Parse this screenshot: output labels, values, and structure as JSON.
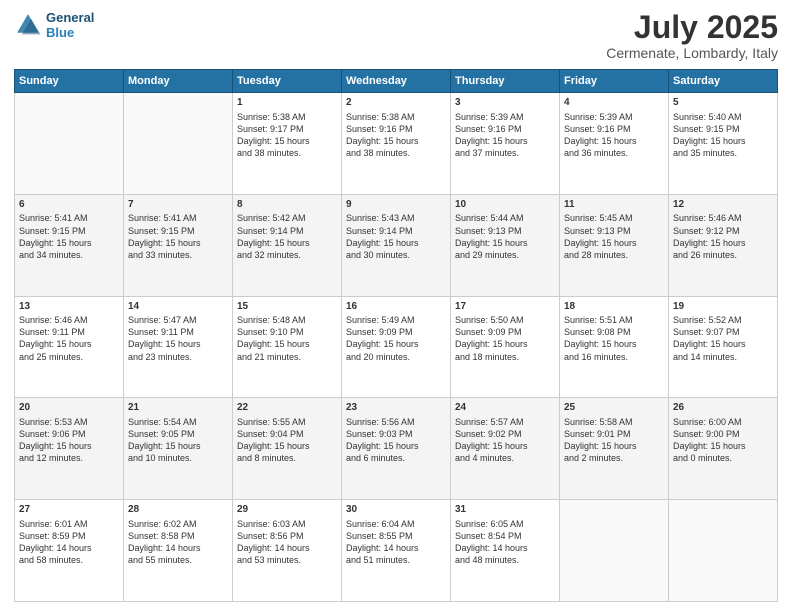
{
  "header": {
    "logo_line1": "General",
    "logo_line2": "Blue",
    "month": "July 2025",
    "location": "Cermenate, Lombardy, Italy"
  },
  "weekdays": [
    "Sunday",
    "Monday",
    "Tuesday",
    "Wednesday",
    "Thursday",
    "Friday",
    "Saturday"
  ],
  "rows": [
    [
      {
        "day": "",
        "text": ""
      },
      {
        "day": "",
        "text": ""
      },
      {
        "day": "1",
        "text": "Sunrise: 5:38 AM\nSunset: 9:17 PM\nDaylight: 15 hours\nand 38 minutes."
      },
      {
        "day": "2",
        "text": "Sunrise: 5:38 AM\nSunset: 9:16 PM\nDaylight: 15 hours\nand 38 minutes."
      },
      {
        "day": "3",
        "text": "Sunrise: 5:39 AM\nSunset: 9:16 PM\nDaylight: 15 hours\nand 37 minutes."
      },
      {
        "day": "4",
        "text": "Sunrise: 5:39 AM\nSunset: 9:16 PM\nDaylight: 15 hours\nand 36 minutes."
      },
      {
        "day": "5",
        "text": "Sunrise: 5:40 AM\nSunset: 9:15 PM\nDaylight: 15 hours\nand 35 minutes."
      }
    ],
    [
      {
        "day": "6",
        "text": "Sunrise: 5:41 AM\nSunset: 9:15 PM\nDaylight: 15 hours\nand 34 minutes."
      },
      {
        "day": "7",
        "text": "Sunrise: 5:41 AM\nSunset: 9:15 PM\nDaylight: 15 hours\nand 33 minutes."
      },
      {
        "day": "8",
        "text": "Sunrise: 5:42 AM\nSunset: 9:14 PM\nDaylight: 15 hours\nand 32 minutes."
      },
      {
        "day": "9",
        "text": "Sunrise: 5:43 AM\nSunset: 9:14 PM\nDaylight: 15 hours\nand 30 minutes."
      },
      {
        "day": "10",
        "text": "Sunrise: 5:44 AM\nSunset: 9:13 PM\nDaylight: 15 hours\nand 29 minutes."
      },
      {
        "day": "11",
        "text": "Sunrise: 5:45 AM\nSunset: 9:13 PM\nDaylight: 15 hours\nand 28 minutes."
      },
      {
        "day": "12",
        "text": "Sunrise: 5:46 AM\nSunset: 9:12 PM\nDaylight: 15 hours\nand 26 minutes."
      }
    ],
    [
      {
        "day": "13",
        "text": "Sunrise: 5:46 AM\nSunset: 9:11 PM\nDaylight: 15 hours\nand 25 minutes."
      },
      {
        "day": "14",
        "text": "Sunrise: 5:47 AM\nSunset: 9:11 PM\nDaylight: 15 hours\nand 23 minutes."
      },
      {
        "day": "15",
        "text": "Sunrise: 5:48 AM\nSunset: 9:10 PM\nDaylight: 15 hours\nand 21 minutes."
      },
      {
        "day": "16",
        "text": "Sunrise: 5:49 AM\nSunset: 9:09 PM\nDaylight: 15 hours\nand 20 minutes."
      },
      {
        "day": "17",
        "text": "Sunrise: 5:50 AM\nSunset: 9:09 PM\nDaylight: 15 hours\nand 18 minutes."
      },
      {
        "day": "18",
        "text": "Sunrise: 5:51 AM\nSunset: 9:08 PM\nDaylight: 15 hours\nand 16 minutes."
      },
      {
        "day": "19",
        "text": "Sunrise: 5:52 AM\nSunset: 9:07 PM\nDaylight: 15 hours\nand 14 minutes."
      }
    ],
    [
      {
        "day": "20",
        "text": "Sunrise: 5:53 AM\nSunset: 9:06 PM\nDaylight: 15 hours\nand 12 minutes."
      },
      {
        "day": "21",
        "text": "Sunrise: 5:54 AM\nSunset: 9:05 PM\nDaylight: 15 hours\nand 10 minutes."
      },
      {
        "day": "22",
        "text": "Sunrise: 5:55 AM\nSunset: 9:04 PM\nDaylight: 15 hours\nand 8 minutes."
      },
      {
        "day": "23",
        "text": "Sunrise: 5:56 AM\nSunset: 9:03 PM\nDaylight: 15 hours\nand 6 minutes."
      },
      {
        "day": "24",
        "text": "Sunrise: 5:57 AM\nSunset: 9:02 PM\nDaylight: 15 hours\nand 4 minutes."
      },
      {
        "day": "25",
        "text": "Sunrise: 5:58 AM\nSunset: 9:01 PM\nDaylight: 15 hours\nand 2 minutes."
      },
      {
        "day": "26",
        "text": "Sunrise: 6:00 AM\nSunset: 9:00 PM\nDaylight: 15 hours\nand 0 minutes."
      }
    ],
    [
      {
        "day": "27",
        "text": "Sunrise: 6:01 AM\nSunset: 8:59 PM\nDaylight: 14 hours\nand 58 minutes."
      },
      {
        "day": "28",
        "text": "Sunrise: 6:02 AM\nSunset: 8:58 PM\nDaylight: 14 hours\nand 55 minutes."
      },
      {
        "day": "29",
        "text": "Sunrise: 6:03 AM\nSunset: 8:56 PM\nDaylight: 14 hours\nand 53 minutes."
      },
      {
        "day": "30",
        "text": "Sunrise: 6:04 AM\nSunset: 8:55 PM\nDaylight: 14 hours\nand 51 minutes."
      },
      {
        "day": "31",
        "text": "Sunrise: 6:05 AM\nSunset: 8:54 PM\nDaylight: 14 hours\nand 48 minutes."
      },
      {
        "day": "",
        "text": ""
      },
      {
        "day": "",
        "text": ""
      }
    ]
  ]
}
